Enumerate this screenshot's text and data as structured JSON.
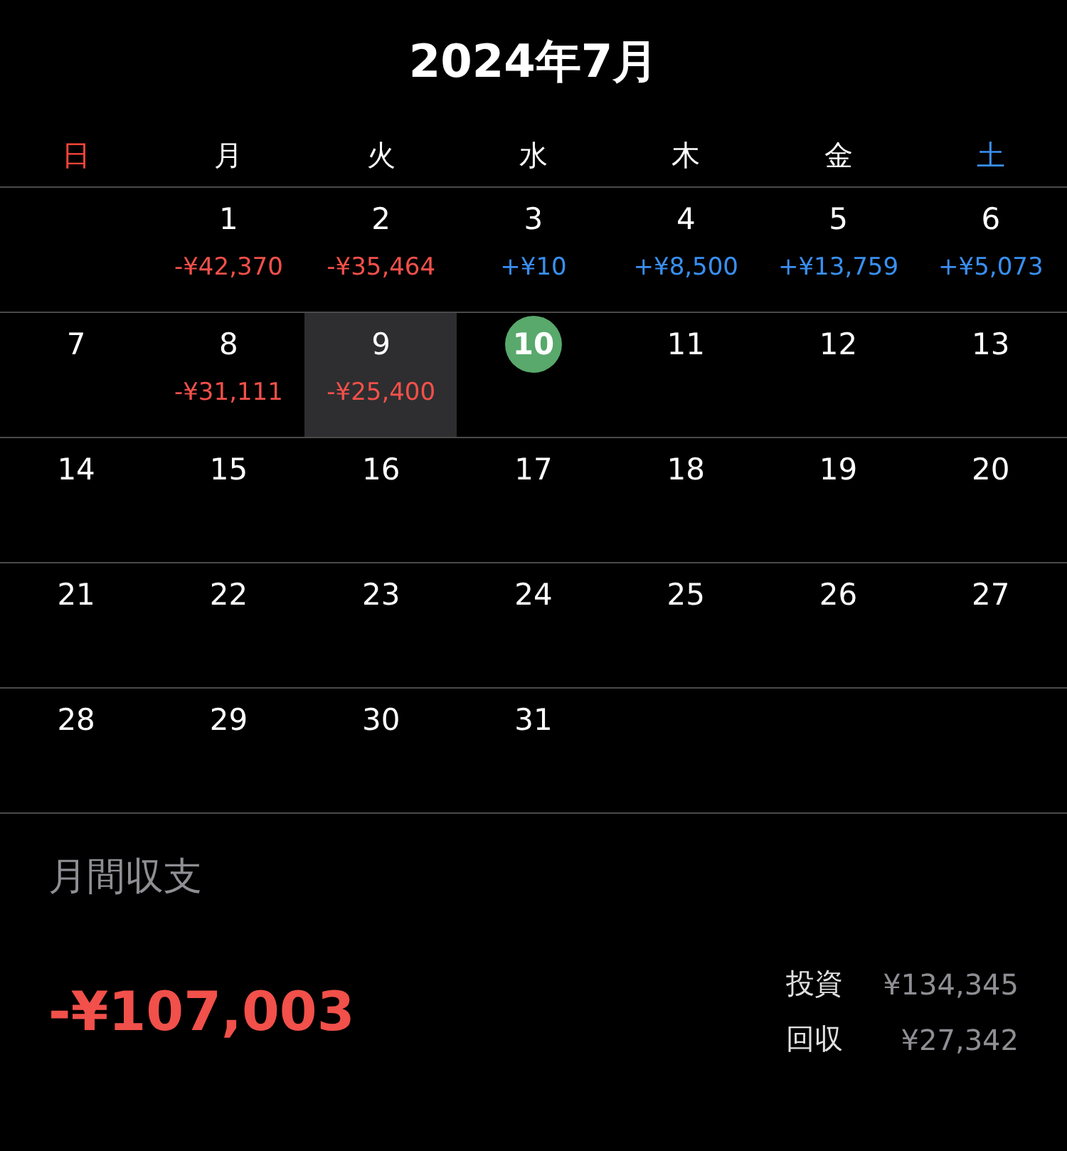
{
  "title": "2024年7月",
  "weekdays": [
    {
      "label": "日",
      "kind": "sunday"
    },
    {
      "label": "月",
      "kind": "weekday"
    },
    {
      "label": "火",
      "kind": "weekday"
    },
    {
      "label": "水",
      "kind": "weekday"
    },
    {
      "label": "木",
      "kind": "weekday"
    },
    {
      "label": "金",
      "kind": "weekday"
    },
    {
      "label": "土",
      "kind": "saturday"
    }
  ],
  "weeks": [
    [
      {
        "kind": "blank"
      },
      {
        "kind": "day",
        "day": "1",
        "amount": "-¥42,370",
        "color": "#f2504a",
        "selected": false,
        "today": false
      },
      {
        "kind": "day",
        "day": "2",
        "amount": "-¥35,464",
        "color": "#f2504a",
        "selected": false,
        "today": false
      },
      {
        "kind": "day",
        "day": "3",
        "amount": "+¥10",
        "color": "#3a8ff0",
        "selected": false,
        "today": false
      },
      {
        "kind": "day",
        "day": "4",
        "amount": "+¥8,500",
        "color": "#3a8ff0",
        "selected": false,
        "today": false
      },
      {
        "kind": "day",
        "day": "5",
        "amount": "+¥13,759",
        "color": "#3a8ff0",
        "selected": false,
        "today": false
      },
      {
        "kind": "day",
        "day": "6",
        "amount": "+¥5,073",
        "color": "#3a8ff0",
        "selected": false,
        "today": false
      }
    ],
    [
      {
        "kind": "day",
        "day": "7",
        "selected": false,
        "today": false
      },
      {
        "kind": "day",
        "day": "8",
        "amount": "-¥31,111",
        "color": "#f2504a",
        "selected": false,
        "today": false
      },
      {
        "kind": "day",
        "day": "9",
        "amount": "-¥25,400",
        "color": "#f2504a",
        "selected": true,
        "today": false
      },
      {
        "kind": "day",
        "day": "10",
        "selected": false,
        "today": true
      },
      {
        "kind": "day",
        "day": "11",
        "selected": false,
        "today": false
      },
      {
        "kind": "day",
        "day": "12",
        "selected": false,
        "today": false
      },
      {
        "kind": "day",
        "day": "13",
        "selected": false,
        "today": false
      }
    ],
    [
      {
        "kind": "day",
        "day": "14",
        "selected": false,
        "today": false
      },
      {
        "kind": "day",
        "day": "15",
        "selected": false,
        "today": false
      },
      {
        "kind": "day",
        "day": "16",
        "selected": false,
        "today": false
      },
      {
        "kind": "day",
        "day": "17",
        "selected": false,
        "today": false
      },
      {
        "kind": "day",
        "day": "18",
        "selected": false,
        "today": false
      },
      {
        "kind": "day",
        "day": "19",
        "selected": false,
        "today": false
      },
      {
        "kind": "day",
        "day": "20",
        "selected": false,
        "today": false
      }
    ],
    [
      {
        "kind": "day",
        "day": "21",
        "selected": false,
        "today": false
      },
      {
        "kind": "day",
        "day": "22",
        "selected": false,
        "today": false
      },
      {
        "kind": "day",
        "day": "23",
        "selected": false,
        "today": false
      },
      {
        "kind": "day",
        "day": "24",
        "selected": false,
        "today": false
      },
      {
        "kind": "day",
        "day": "25",
        "selected": false,
        "today": false
      },
      {
        "kind": "day",
        "day": "26",
        "selected": false,
        "today": false
      },
      {
        "kind": "day",
        "day": "27",
        "selected": false,
        "today": false
      }
    ],
    [
      {
        "kind": "day",
        "day": "28",
        "selected": false,
        "today": false
      },
      {
        "kind": "day",
        "day": "29",
        "selected": false,
        "today": false
      },
      {
        "kind": "day",
        "day": "30",
        "selected": false,
        "today": false
      },
      {
        "kind": "day",
        "day": "31",
        "selected": false,
        "today": false
      },
      {
        "kind": "blank"
      },
      {
        "kind": "blank"
      },
      {
        "kind": "blank"
      }
    ]
  ],
  "summary": {
    "heading": "月間収支",
    "total": "-¥107,003",
    "breakdown": [
      {
        "label": "投資",
        "value": "¥134,345"
      },
      {
        "label": "回収",
        "value": "¥27,342"
      }
    ]
  }
}
